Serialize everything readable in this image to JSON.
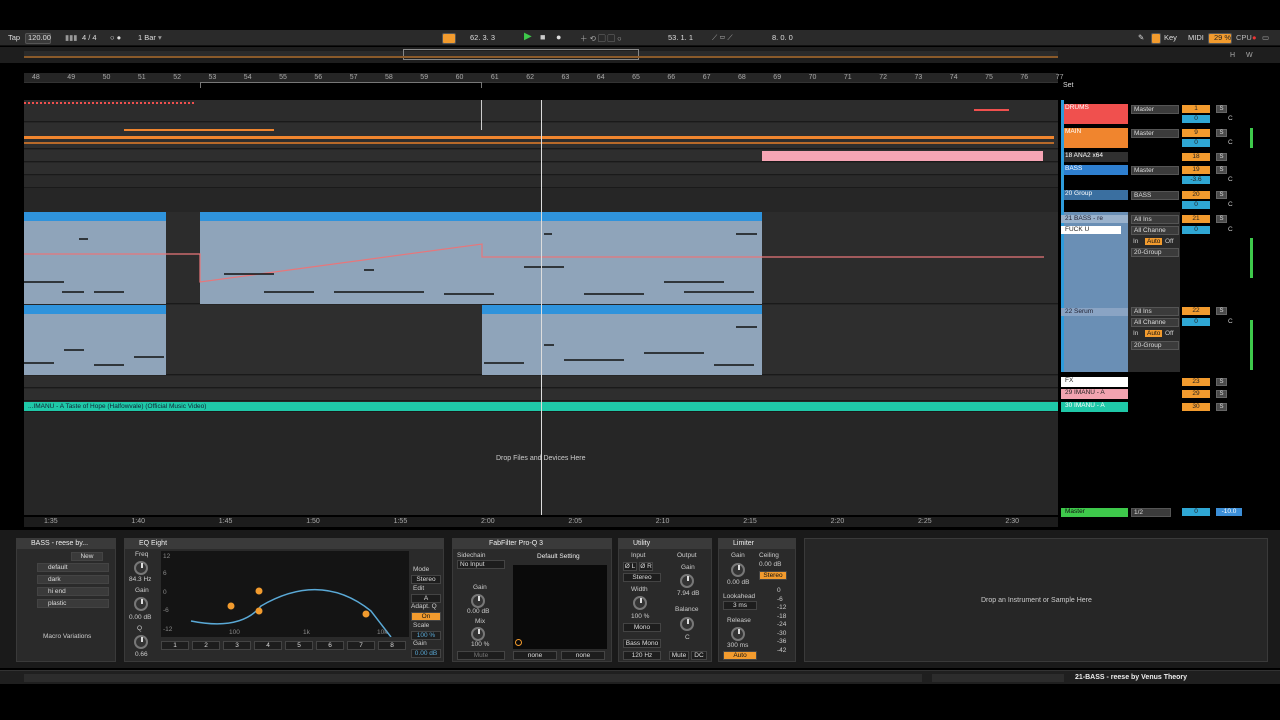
{
  "transport": {
    "tap": "Tap",
    "tempo": "120.00",
    "signature": "4 / 4",
    "quantize": "1 Bar",
    "position": "62.  3.  3",
    "loop_start": "53.  1.  1",
    "loop_length": "8.  0.  0",
    "key": "Key",
    "midi": "MIDI",
    "cpu_value": "29 %",
    "cpu_label": "CPU"
  },
  "io_letters": {
    "h": "H",
    "w": "W"
  },
  "ruler": [
    "48",
    "49",
    "50",
    "51",
    "52",
    "53",
    "54",
    "55",
    "56",
    "57",
    "58",
    "59",
    "60",
    "61",
    "62",
    "63",
    "64",
    "65",
    "66",
    "67",
    "68",
    "69",
    "70",
    "71",
    "72",
    "73",
    "74",
    "75",
    "76",
    "77"
  ],
  "set_label": "Set",
  "tracks": [
    {
      "name": "DRUMS",
      "color": "#f0504e",
      "out": "Master",
      "num": "1",
      "vol": "0",
      "pan": "C"
    },
    {
      "name": "MAIN",
      "color": "#f0852e",
      "out": "Master",
      "num": "9",
      "vol": "0",
      "pan": "C"
    },
    {
      "name": "18 ANA2 x64",
      "color": "#303030",
      "out": "",
      "num": "18",
      "vol": "",
      "pan": ""
    },
    {
      "name": "BASS",
      "color": "#2e7fd0",
      "out": "Master",
      "num": "19",
      "vol": "-3.6",
      "pan": "C"
    },
    {
      "name": "20 Group",
      "color": "#3a6fa0",
      "out": "BASS",
      "num": "20",
      "vol": "0",
      "pan": "C"
    },
    {
      "name": "21 BASS - re",
      "color": "#6a8fb5",
      "out": "All Ins",
      "num": "21",
      "vol": "0",
      "pan": "C"
    },
    {
      "name": "22 Serum",
      "color": "#5a7fa5",
      "out": "All Ins",
      "num": "22",
      "vol": "0",
      "pan": "C"
    },
    {
      "name": "FX",
      "color": "#ffffff",
      "out": "",
      "num": "23",
      "vol": "",
      "pan": ""
    },
    {
      "name": "29 IMANU - A",
      "color": "#f2a3b0",
      "out": "",
      "num": "29",
      "vol": "",
      "pan": ""
    },
    {
      "name": "30 IMANU - A",
      "color": "#1fc8a8",
      "out": "",
      "num": "30",
      "vol": "",
      "pan": ""
    }
  ],
  "track21": {
    "sub_name": "FUCK U",
    "chan": "All Channe",
    "monitor_in": "In",
    "monitor_auto": "Auto",
    "monitor_off": "Off",
    "group": "20-Group"
  },
  "track22": {
    "chan": "All Channe",
    "monitor_in": "In",
    "monitor_auto": "Auto",
    "monitor_off": "Off",
    "group": "20-Group"
  },
  "solo_label": "S",
  "audio_clip": "...IMANU - A Taste of Hope (Halfowvale) (Official Music Video)",
  "drop_files": "Drop Files and Devices Here",
  "master": {
    "name": "Master",
    "out": "1/2",
    "vol": "0",
    "level": "-10.0"
  },
  "timeaxis": [
    "1:35",
    "1:40",
    "1:45",
    "1:50",
    "1:55",
    "2:00",
    "2:05",
    "2:10",
    "2:15",
    "2:20",
    "2:25",
    "2:30"
  ],
  "rack": {
    "title": "BASS - reese by...",
    "new": "New",
    "variations": [
      "default",
      "dark",
      "hi end",
      "plastic"
    ],
    "footer": "Macro Variations"
  },
  "eq": {
    "title": "EQ Eight",
    "freq_label": "Freq",
    "freq": "84.3 Hz",
    "gain_label": "Gain",
    "gain": "0.00 dB",
    "q_label": "Q",
    "q": "0.66",
    "mode_label": "Mode",
    "mode": "Stereo",
    "edit_label": "Edit",
    "edit_a": "A",
    "adapt_label": "Adapt. Q",
    "adapt": "On",
    "scale_label": "Scale",
    "scale": "100 %",
    "out_gain_label": "Gain",
    "out_gain": "0.00 dB",
    "db_ticks": [
      "12",
      "6",
      "0",
      "-6",
      "-12"
    ],
    "freq_ticks": [
      "100",
      "1k",
      "10k"
    ],
    "bands": [
      "1",
      "2",
      "3",
      "4",
      "5",
      "6",
      "7",
      "8"
    ]
  },
  "proq": {
    "title": "FabFilter Pro-Q 3",
    "preset": "Default Setting",
    "sidechain_label": "Sidechain",
    "sidechain": "No Input",
    "gain_label": "Gain",
    "gain": "0.00 dB",
    "mix_label": "Mix",
    "mix": "100 %",
    "mute": "Mute",
    "none1": "none",
    "none2": "none"
  },
  "utility": {
    "title": "Utility",
    "input": "Input",
    "output": "Output",
    "phase_l": "Ø L",
    "phase_r": "Ø R",
    "mode": "Stereo",
    "gain_label": "Gain",
    "gain": "7.94 dB",
    "width_label": "Width",
    "width": "100 %",
    "mono": "Mono",
    "balance_label": "Balance",
    "balance": "C",
    "bass_mono": "Bass Mono",
    "bass_freq": "120 Hz",
    "mute": "Mute",
    "dc": "DC"
  },
  "limiter": {
    "title": "Limiter",
    "gain_label": "Gain",
    "gain": "0.00 dB",
    "ceiling_label": "Ceiling",
    "ceiling": "0.00 dB",
    "stereo": "Stereo",
    "lookahead_label": "Lookahead",
    "lookahead": "3 ms",
    "release_label": "Release",
    "release": "300 ms",
    "auto": "Auto",
    "scale": [
      "0",
      "-6",
      "-12",
      "-18",
      "-24",
      "-30",
      "-36",
      "-42"
    ]
  },
  "drop_instrument": "Drop an Instrument or Sample Here",
  "status_text": "21-BASS - reese by Venus Theory"
}
